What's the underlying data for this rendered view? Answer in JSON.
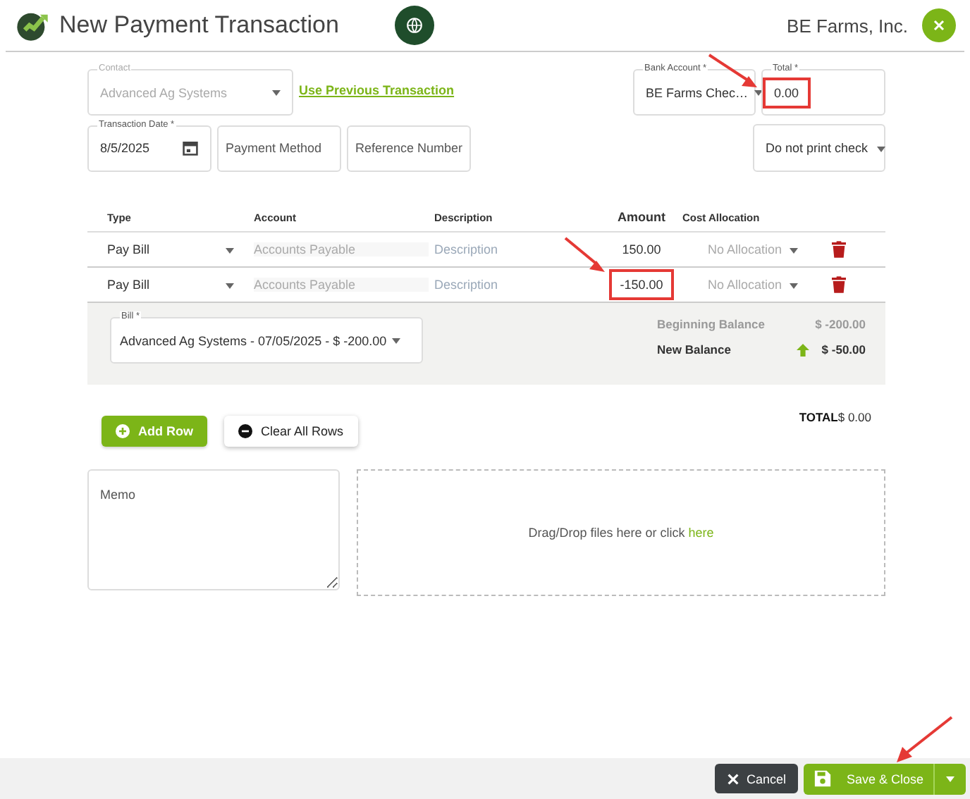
{
  "header": {
    "title": "New Payment Transaction",
    "org_name": "BE Farms, Inc."
  },
  "contact": {
    "label": "Contact",
    "value": "Advanced Ag Systems",
    "disabled": true
  },
  "previous_link": "Use Previous Transaction",
  "bank_account": {
    "label": "Bank Account *",
    "value": "BE Farms Chec…"
  },
  "total_field": {
    "label": "Total *",
    "value": "0.00",
    "highlighted": true
  },
  "transaction_date": {
    "label": "Transaction Date *",
    "value": "8/5/2025"
  },
  "payment_method": {
    "placeholder": "Payment Method"
  },
  "reference_number": {
    "placeholder": "Reference Number"
  },
  "print_option": {
    "value": "Do not print check"
  },
  "table": {
    "columns": [
      "Type",
      "Account",
      "Description",
      "Amount",
      "Cost Allocation"
    ],
    "rows": [
      {
        "type": "Pay Bill",
        "account": "Accounts Payable",
        "description": "Description",
        "amount": "150.00",
        "allocation": "No Allocation",
        "highlighted": false
      },
      {
        "type": "Pay Bill",
        "account": "Accounts Payable",
        "description": "Description",
        "amount": "-150.00",
        "allocation": "No Allocation",
        "highlighted": true
      }
    ]
  },
  "bill": {
    "label": "Bill *",
    "value": "Advanced Ag Systems - 07/05/2025 - $ -200.00"
  },
  "balances": [
    {
      "kind": "beginning",
      "label": "Beginning Balance",
      "value": "$ -200.00"
    },
    {
      "kind": "new",
      "label": "New Balance",
      "value": "$ -50.00"
    }
  ],
  "add_row": "Add Row",
  "clear_rows": "Clear All Rows",
  "total": {
    "label": "TOTAL",
    "value": "$ 0.00"
  },
  "memo": {
    "placeholder": "Memo"
  },
  "dropzone": {
    "text": "Drag/Drop files here or click",
    "link": "here"
  },
  "footer": {
    "cancel": "Cancel",
    "save": "Save & Close"
  }
}
